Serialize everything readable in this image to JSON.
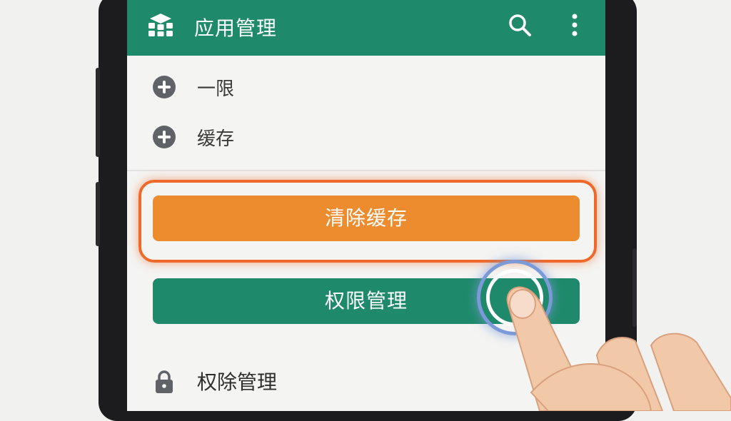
{
  "app_bar": {
    "title": "应用管理",
    "logo_icon": "app-grid-logo-icon",
    "search_icon": "search-icon",
    "more_icon": "more-vert-icon",
    "background": "#1f8a6b"
  },
  "list": {
    "items": [
      {
        "label": "一限",
        "icon": "plus-circle-icon"
      },
      {
        "label": "缓存",
        "icon": "plus-circle-icon"
      }
    ]
  },
  "actions": {
    "clear_cache_label": "清除缓存",
    "clear_cache_color": "#ec8c2e",
    "permissions_label": "权限管理",
    "permissions_color": "#1f8a6b"
  },
  "bottom_item": {
    "label": "权除管理",
    "icon": "lock-icon"
  }
}
